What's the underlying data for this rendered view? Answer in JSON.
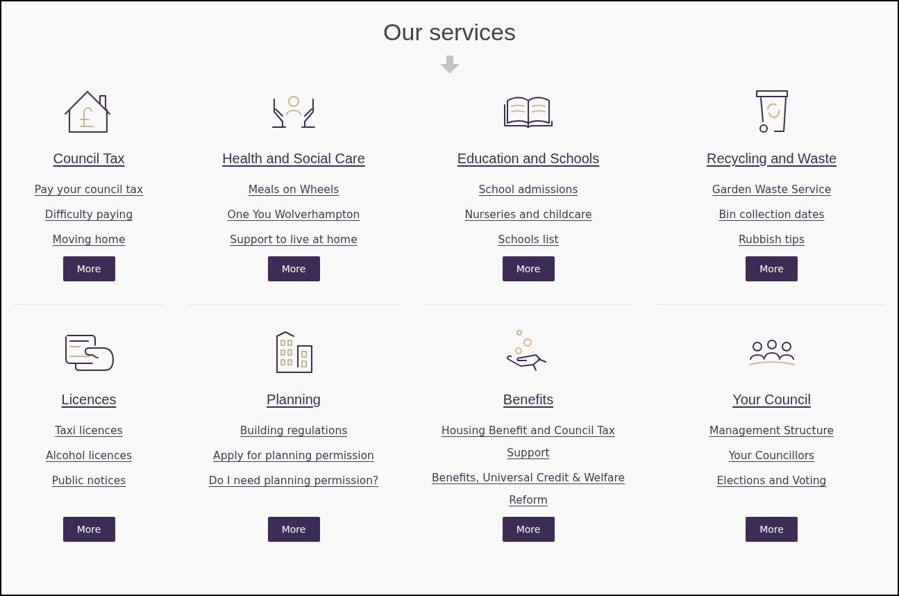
{
  "title": "Our services",
  "services": [
    {
      "kind": "council-tax",
      "heading": "Council Tax",
      "links": [
        "Pay your council tax",
        "Difficulty paying",
        "Moving home"
      ],
      "button": "More"
    },
    {
      "kind": "care",
      "heading": "Health and Social Care",
      "links": [
        "Meals on Wheels",
        "One You Wolverhampton",
        "Support to live at home"
      ],
      "button": "More"
    },
    {
      "kind": "education",
      "heading": "Education and Schools",
      "links": [
        "School admissions",
        "Nurseries and childcare",
        "Schools list"
      ],
      "button": "More"
    },
    {
      "kind": "recycling",
      "heading": "Recycling and Waste",
      "links": [
        "Garden Waste Service",
        "Bin collection dates",
        "Rubbish tips"
      ],
      "button": "More"
    },
    {
      "kind": "licences",
      "heading": "Licences",
      "links": [
        "Taxi licences",
        "Alcohol licences",
        "Public notices"
      ],
      "button": "More"
    },
    {
      "kind": "planning",
      "heading": "Planning",
      "links": [
        "Building regulations",
        "Apply for planning permission",
        "Do I need planning permission?"
      ],
      "button": "More"
    },
    {
      "kind": "benefits",
      "heading": "Benefits",
      "links": [
        "Housing Benefit and Council Tax Support",
        "Benefits, Universal Credit & Welfare Reform"
      ],
      "button": "More"
    },
    {
      "kind": "council",
      "heading": "Your Council",
      "links": [
        "Management Structure",
        "Your Councillors",
        "Elections and Voting"
      ],
      "button": "More"
    }
  ]
}
